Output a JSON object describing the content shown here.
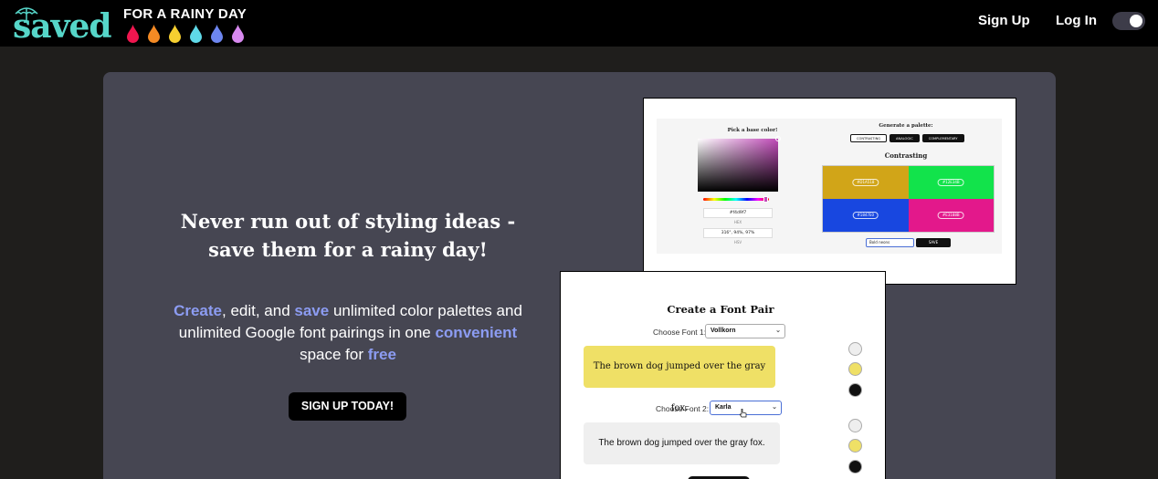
{
  "header": {
    "logo_main": "saved",
    "logo_tagline": "FOR A RAINY DAY",
    "drop_colors": [
      "#f0164f",
      "#f48a24",
      "#f6cf30",
      "#5fd9e8",
      "#6d86f0",
      "#d88af0"
    ],
    "nav": {
      "signup": "Sign Up",
      "login": "Log In"
    },
    "dark_mode_on": true
  },
  "hero": {
    "title_line1": "Never run out of styling ideas -",
    "title_line2": "save them for a rainy day!",
    "desc": {
      "w1": "Create",
      "t1": ", edit, and ",
      "w2": "save",
      "t2": " unlimited color palettes and unlimited Google font pairings in one ",
      "w3": "convenient",
      "t3": " space for ",
      "w4": "free"
    },
    "cta": "SIGN UP TODAY!"
  },
  "palette_preview": {
    "pick_label": "Pick a base color!",
    "hex_value": "#f4d9f7",
    "hex_label": "HEX",
    "hsv_value": "316°, 94%, 97%",
    "hsv_label": "HSV",
    "generate_label": "Generate a palette:",
    "modes": [
      "CONTRASTING",
      "ANALOGIC",
      "COMPLEMENTARY"
    ],
    "active_mode": "Contrasting",
    "swatches": [
      {
        "hex": "#D1A518",
        "color": "#d1a518"
      },
      {
        "hex": "#12E34B",
        "color": "#12e34b"
      },
      {
        "hex": "#1847E0",
        "color": "#1847e0"
      },
      {
        "hex": "#E3188B",
        "color": "#e3188b"
      }
    ],
    "name_input": "Bold neons",
    "save_label": "SAVE"
  },
  "font_preview": {
    "title": "Create a Font Pair",
    "font1_label": "Choose Font 1:",
    "font1_value": "Vollkorn",
    "font2_label": "Choose Font 2:",
    "font2_value": "Karla",
    "sample_text": "The brown dog jumped over the gray fox.",
    "swatches_top": [
      "#eeeeee",
      "#efe066",
      "#111111"
    ],
    "swatches_bottom": [
      "#eeeeee",
      "#efe066",
      "#111111"
    ]
  }
}
